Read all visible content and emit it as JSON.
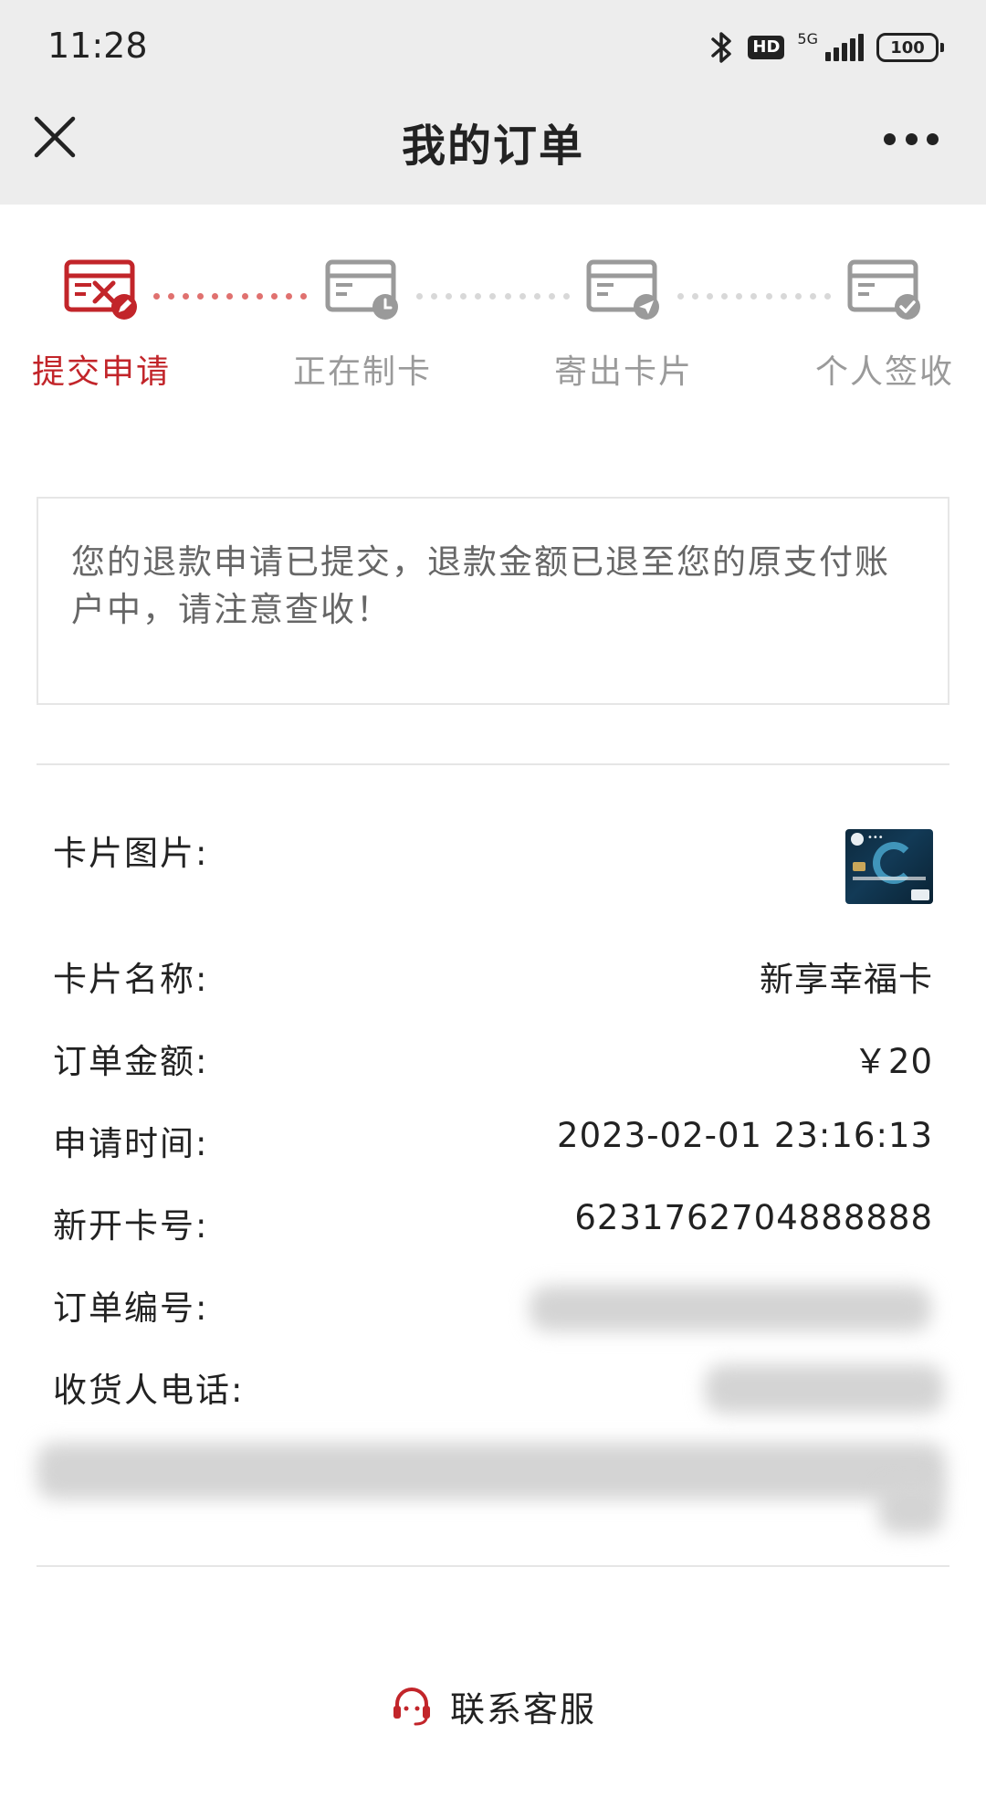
{
  "status_bar": {
    "time": "11:28",
    "network": "5G",
    "hd": "HD",
    "battery": "100",
    "icons": [
      "bluetooth-icon",
      "hd-icon",
      "signal-icon",
      "battery-icon"
    ]
  },
  "nav": {
    "title": "我的订单",
    "close_icon": "close-icon",
    "more_icon": "more-icon"
  },
  "steps": [
    {
      "label": "提交申请",
      "icon": "card-cancel-icon",
      "active": true
    },
    {
      "label": "正在制卡",
      "icon": "card-clock-icon",
      "active": false
    },
    {
      "label": "寄出卡片",
      "icon": "card-send-icon",
      "active": false
    },
    {
      "label": "个人签收",
      "icon": "card-check-icon",
      "active": false
    }
  ],
  "notice": {
    "text": "您的退款申请已提交，退款金额已退至您的原支付账户中，请注意查收！"
  },
  "details": {
    "card_image_label": "卡片图片:",
    "card_name_label": "卡片名称:",
    "card_name": "新享幸福卡",
    "amount_label": "订单金额:",
    "amount": "￥20",
    "apply_time_label": "申请时间:",
    "apply_time": "2023-02-01 23:16:13",
    "card_number_label": "新开卡号:",
    "card_number": "6231762704888888",
    "order_no_label": "订单编号:",
    "phone_label": "收货人电话:"
  },
  "support": {
    "label": "联系客服",
    "icon": "headset-icon"
  },
  "colors": {
    "accent": "#c2252a",
    "inactive": "#9a9a9a",
    "background": "#ffffff",
    "header_bg": "#ededed"
  }
}
